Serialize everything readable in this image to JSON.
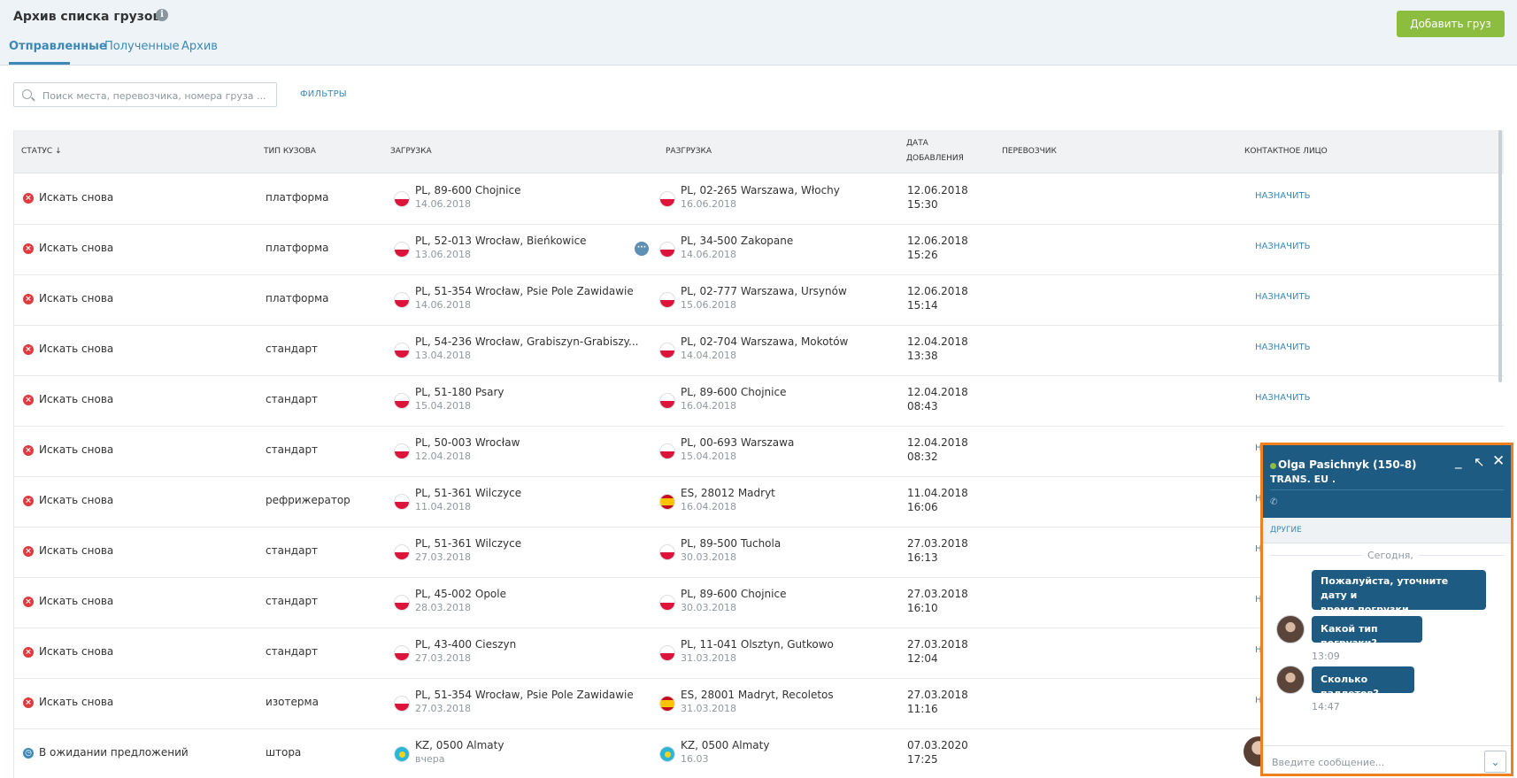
{
  "header": {
    "title": "Архив списка грузов",
    "info_icon": "i",
    "add_button": "Добавить груз",
    "tabs": [
      {
        "label": "Отправленные",
        "active": true
      },
      {
        "label": "Полученные",
        "active": false
      },
      {
        "label": "Архив",
        "active": false
      }
    ]
  },
  "search": {
    "placeholder": "Поиск места, перевозчика, номера груза ...",
    "filters_label": "ФИЛЬТРЫ"
  },
  "table": {
    "columns": {
      "status": "СТАТУС ↓",
      "body_type": "ТИП КУЗОВА",
      "loading": "ЗАГРУЗКА",
      "unloading": "РАЗГРУЗКА",
      "date_added_1": "ДАТА",
      "date_added_2": "ДОБАВЛЕНИЯ",
      "carrier": "ПЕРЕВОЗЧИК",
      "contact": "КОНТАКТНОЕ ЛИЦО"
    },
    "assign_label": "НАЗНАЧИТЬ",
    "rows": [
      {
        "status": "Искать снова",
        "body": "платформа",
        "load": "PL, 89-600 Chojnice",
        "load_date": "14.06.2018",
        "load_flag": "pl",
        "unload": "PL, 02-265 Warszawa, Włochy",
        "unload_date": "16.06.2018",
        "unload_flag": "pl",
        "date": "12.06.2018",
        "time": "15:30"
      },
      {
        "status": "Искать снова",
        "body": "платформа",
        "load": "PL, 52-013 Wrocław, Bieńkowice",
        "load_date": "13.06.2018",
        "load_flag": "pl",
        "unload": "PL, 34-500 Zakopane",
        "unload_date": "14.06.2018",
        "unload_flag": "pl",
        "date": "12.06.2018",
        "time": "15:26"
      },
      {
        "status": "Искать снова",
        "body": "платформа",
        "load": "PL, 51-354 Wrocław, Psie Pole Zawidawie",
        "load_date": "14.06.2018",
        "load_flag": "pl",
        "unload": "PL, 02-777 Warszawa, Ursynów",
        "unload_date": "15.06.2018",
        "unload_flag": "pl",
        "date": "12.06.2018",
        "time": "15:14"
      },
      {
        "status": "Искать снова",
        "body": "стандарт",
        "load": "PL, 54-236 Wrocław, Grabiszyn-Grabiszy...",
        "load_date": "13.04.2018",
        "load_flag": "pl",
        "unload": "PL, 02-704 Warszawa, Mokotów",
        "unload_date": "14.04.2018",
        "unload_flag": "pl",
        "date": "12.04.2018",
        "time": "13:38"
      },
      {
        "status": "Искать снова",
        "body": "стандарт",
        "load": "PL, 51-180 Psary",
        "load_date": "15.04.2018",
        "load_flag": "pl",
        "unload": "PL, 89-600 Chojnice",
        "unload_date": "16.04.2018",
        "unload_flag": "pl",
        "date": "12.04.2018",
        "time": "08:43"
      },
      {
        "status": "Искать снова",
        "body": "стандарт",
        "load": "PL, 50-003 Wrocław",
        "load_date": "12.04.2018",
        "load_flag": "pl",
        "unload": "PL, 00-693 Warszawa",
        "unload_date": "15.04.2018",
        "unload_flag": "pl",
        "date": "12.04.2018",
        "time": "08:32"
      },
      {
        "status": "Искать снова",
        "body": "рефрижератор",
        "load": "PL, 51-361 Wilczyce",
        "load_date": "11.04.2018",
        "load_flag": "pl",
        "unload": "ES, 28012 Madryt",
        "unload_date": "16.04.2018",
        "unload_flag": "es",
        "date": "11.04.2018",
        "time": "16:06"
      },
      {
        "status": "Искать снова",
        "body": "стандарт",
        "load": "PL, 51-361 Wilczyce",
        "load_date": "27.03.2018",
        "load_flag": "pl",
        "unload": "PL, 89-500 Tuchola",
        "unload_date": "30.03.2018",
        "unload_flag": "pl",
        "date": "27.03.2018",
        "time": "16:13"
      },
      {
        "status": "Искать снова",
        "body": "стандарт",
        "load": "PL, 45-002 Opole",
        "load_date": "28.03.2018",
        "load_flag": "pl",
        "unload": "PL, 89-600 Chojnice",
        "unload_date": "30.03.2018",
        "unload_flag": "pl",
        "date": "27.03.2018",
        "time": "16:10"
      },
      {
        "status": "Искать снова",
        "body": "стандарт",
        "load": "PL, 43-400 Cieszyn",
        "load_date": "27.03.2018",
        "load_flag": "pl",
        "unload": "PL, 11-041 Olsztyn, Gutkowo",
        "unload_date": "31.03.2018",
        "unload_flag": "pl",
        "date": "27.03.2018",
        "time": "12:04"
      },
      {
        "status": "Искать снова",
        "body": "изотерма",
        "load": "PL, 51-354 Wrocław, Psie Pole Zawidawie",
        "load_date": "27.03.2018",
        "load_flag": "pl",
        "unload": "ES, 28001 Madryt, Recoletos",
        "unload_date": "31.03.2018",
        "unload_flag": "es",
        "date": "27.03.2018",
        "time": "11:16"
      },
      {
        "status": "В ожидании предложений",
        "body": "штора",
        "load": "KZ, 0500 Almaty",
        "load_date": "вчера",
        "load_flag": "kz",
        "unload": "KZ, 0500 Almaty",
        "unload_date": "16.03",
        "unload_flag": "kz",
        "date": "07.03.2020",
        "time": "17:25"
      }
    ],
    "partial_assign_text": "Н"
  },
  "chat": {
    "name": "Olga Pasichnyk (150-8)",
    "company": "TRANS. EU .",
    "others_label": "ДРУГИЕ",
    "day_separator": "Сегодня,",
    "messages": [
      {
        "text_1": "Пожалуйста, уточните дату и",
        "text_2": "время погрузки.",
        "time": ""
      },
      {
        "text": "Какой тип погрузки?",
        "time": "13:09"
      },
      {
        "text": "Сколько паллетов?",
        "time": "14:47"
      }
    ],
    "input_placeholder": "Введите сообщение..."
  },
  "colors": {
    "accent": "#3d88b5",
    "add_button": "#8cbd3f",
    "chat_header": "#1d5b83",
    "chat_highlight_border": "#f07f1e",
    "error_status": "#e0393e"
  }
}
